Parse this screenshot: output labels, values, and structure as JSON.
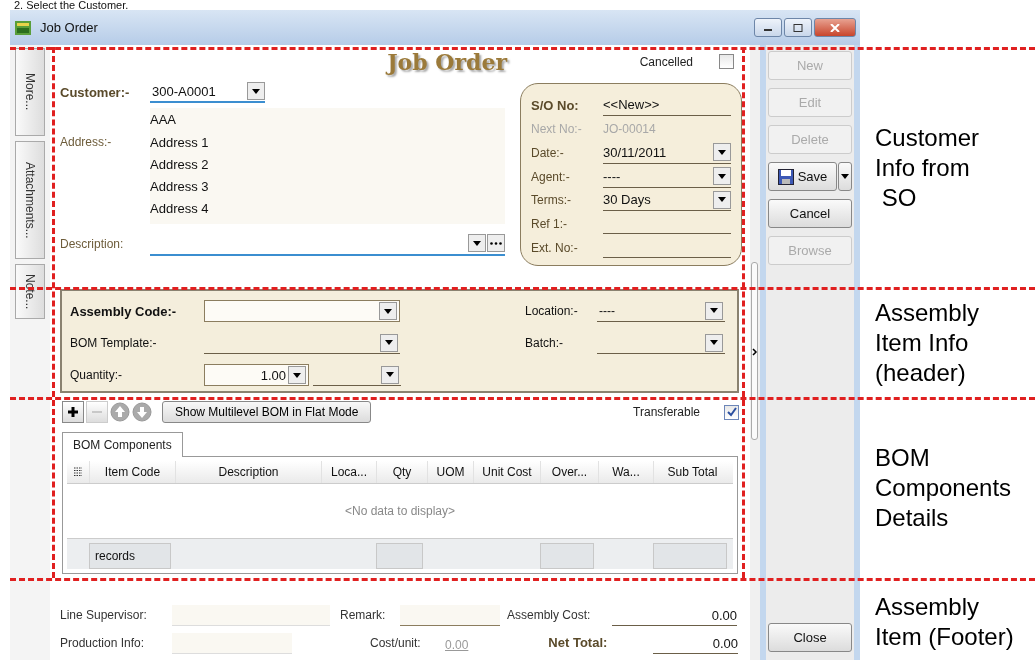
{
  "heading": "2.   Select the Customer.",
  "window": {
    "title": "Job Order"
  },
  "side_tabs": [
    {
      "label": "More..."
    },
    {
      "label": "Attachments..."
    },
    {
      "label": "Note..."
    }
  ],
  "form_title": "Job Order",
  "cancelled": {
    "label": "Cancelled",
    "checked": false
  },
  "customer": {
    "label": "Customer:-",
    "value": "300-A0001",
    "name": "AAA"
  },
  "address": {
    "label": "Address:-",
    "lines": [
      "Address 1",
      "Address 2",
      "Address 3",
      "Address 4"
    ]
  },
  "description": {
    "label": "Description:"
  },
  "so_fields": [
    {
      "kind": "heading",
      "label": "S/O No:",
      "value": "<<New>>"
    },
    {
      "kind": "info",
      "label": "Next No:-",
      "value": "JO-00014"
    },
    {
      "kind": "dropdown",
      "label": "Date:-",
      "value": "30/11/2011"
    },
    {
      "kind": "dropdown",
      "label": "Agent:-",
      "value": "----"
    },
    {
      "kind": "dropdown",
      "label": "Terms:-",
      "value": "30 Days"
    },
    {
      "kind": "text",
      "label": "Ref 1:-"
    },
    {
      "kind": "text",
      "label": "Ext. No:-"
    }
  ],
  "buttons": [
    {
      "label": "New",
      "kind": "plain",
      "disabled": true
    },
    {
      "label": "Edit",
      "kind": "plain",
      "disabled": true
    },
    {
      "label": "Delete",
      "kind": "plain",
      "disabled": true
    },
    {
      "label": "Save",
      "kind": "split",
      "disabled": false
    },
    {
      "label": "Cancel",
      "kind": "plain",
      "disabled": false
    },
    {
      "label": "Browse",
      "kind": "plain",
      "disabled": true
    }
  ],
  "assembly": {
    "code_label": "Assembly Code:-",
    "template_label": "BOM Template:-",
    "quantity_label": "Quantity:-",
    "quantity": "1.00",
    "location_label": "Location:-",
    "location": "----",
    "batch_label": "Batch:-"
  },
  "toolbar": {
    "flat_button": "Show Multilevel BOM in Flat Mode",
    "transferable": {
      "label": "Transferable",
      "checked": true
    }
  },
  "tabs": [
    {
      "label": "BOM Components",
      "selected": true
    }
  ],
  "table": {
    "columns": [
      "Item Code",
      "Description",
      "Loca...",
      "Qty",
      "UOM",
      "Unit Cost",
      "Over...",
      "Wa...",
      "Sub Total"
    ],
    "empty_text": "<No data to display>",
    "footer_label": "records"
  },
  "footer": {
    "line_supervisor": "Line Supervisor:",
    "production_info": "Production Info:",
    "remark": "Remark:",
    "cost_unit_label": "Cost/unit:",
    "cost_unit": "0.00",
    "assembly_cost_label": "Assembly Cost:",
    "assembly_cost": "0.00",
    "net_total_label": "Net Total:",
    "net_total": "0.00"
  },
  "close_button": "Close",
  "annotations": [
    {
      "lines": [
        "Customer",
        "Info from",
        " SO"
      ]
    },
    {
      "lines": [
        "Assembly",
        "Item Info",
        "(header)"
      ]
    },
    {
      "lines": [
        "BOM",
        "Components",
        "Details"
      ]
    },
    {
      "lines": [
        "Assembly",
        "Item (Footer)"
      ]
    }
  ]
}
